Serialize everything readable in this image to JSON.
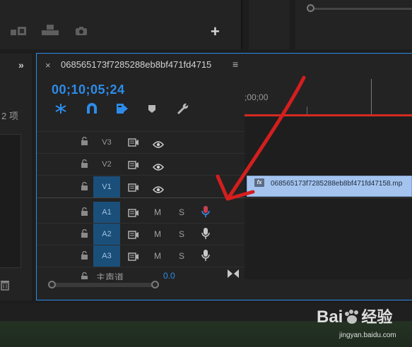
{
  "project_panel": {
    "items_count": "2 项"
  },
  "timeline": {
    "sequence_name": "068565173f7285288eb8bf471fd4715",
    "timecode": "00;10;05;24",
    "ruler_label": ";00;00",
    "tracks": [
      {
        "name": "V3",
        "type": "video",
        "targeted": false
      },
      {
        "name": "V2",
        "type": "video",
        "targeted": false
      },
      {
        "name": "V1",
        "type": "video",
        "targeted": true
      },
      {
        "name": "A1",
        "type": "audio",
        "targeted": true,
        "mic_active": true
      },
      {
        "name": "A2",
        "type": "audio",
        "targeted": true,
        "mic_active": false
      },
      {
        "name": "A3",
        "type": "audio",
        "targeted": true,
        "mic_active": false
      }
    ],
    "mute_label": "M",
    "solo_label": "S",
    "master": {
      "label": "主声道",
      "value": "0.0"
    },
    "clip": {
      "fx_label": "fx",
      "name": "068565173f7285288eb8bf471fd47158.mp"
    }
  },
  "watermark": {
    "brand": "Bai",
    "brand_cn": "经验",
    "url": "jingyan.baidu.com"
  },
  "colors": {
    "accent": "#2d8ceb",
    "playhead": "#d42a20",
    "clip": "#a4c4ef",
    "annotation_arrow": "#d41e1e"
  }
}
